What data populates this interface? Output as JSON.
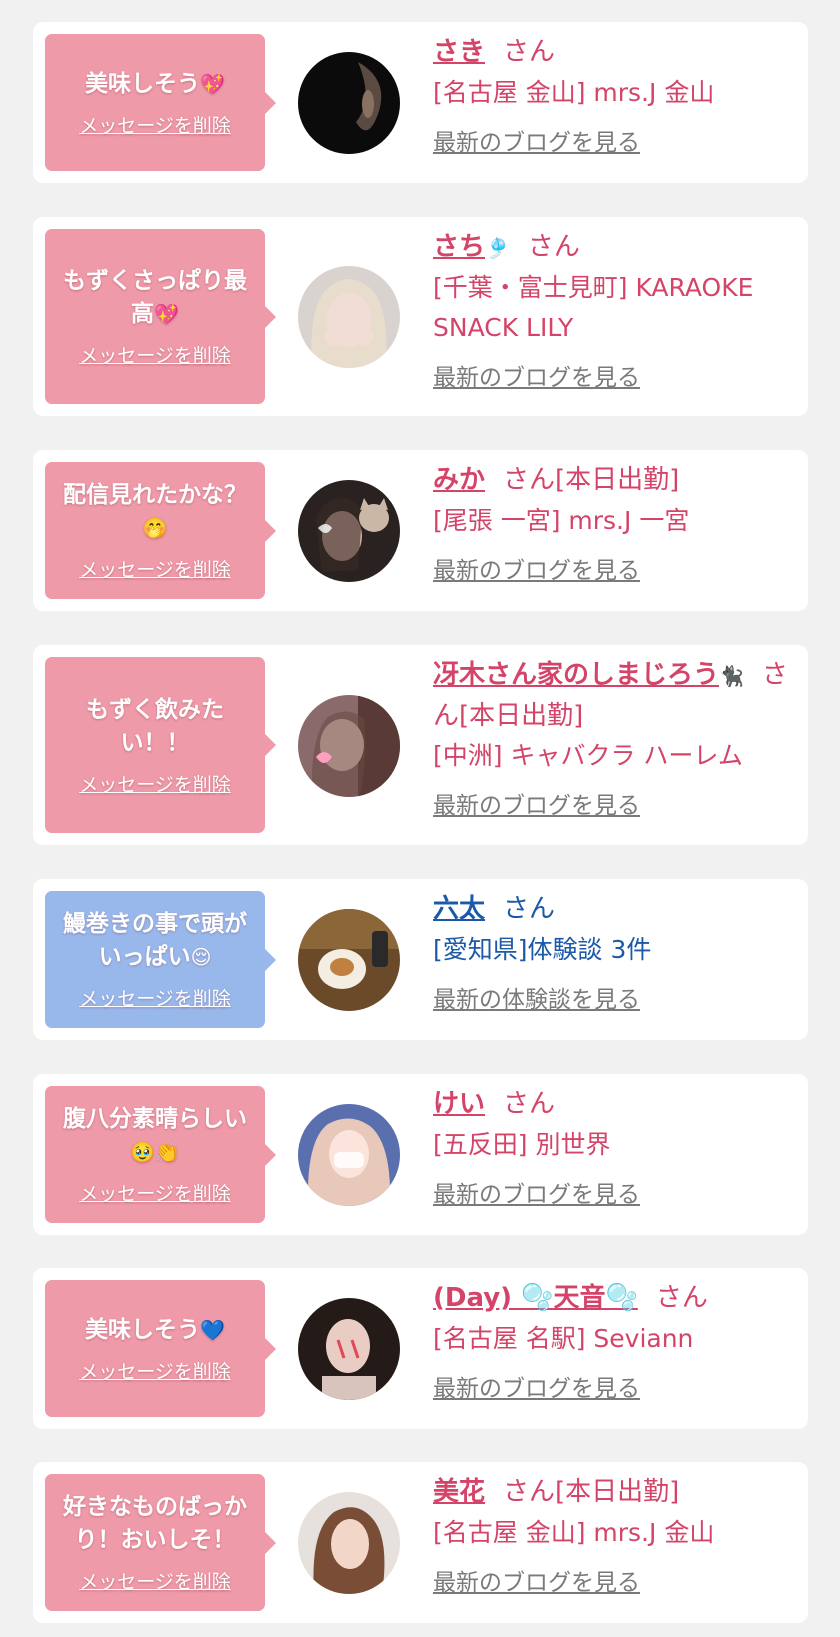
{
  "items": [
    {
      "bubble_text": "美味しそう",
      "bubble_emoji": "💖",
      "delete_label": "メッセージを削除",
      "name": "さき",
      "name_suffix": "",
      "honorific": "さん",
      "status": "",
      "shop": "[名古屋 金山] mrs.J 金山",
      "link_label": "最新のブログを見る"
    },
    {
      "bubble_text": "もずくさっぱり最高",
      "bubble_emoji": "💖",
      "delete_label": "メッセージを削除",
      "name": "さち",
      "name_suffix": "🎐",
      "honorific": "さん",
      "status": "",
      "shop": "[千葉・富士見町] KARAOKE SNACK LILY",
      "link_label": "最新のブログを見る"
    },
    {
      "bubble_text": "配信見れたかな？",
      "bubble_emoji": "🤭",
      "delete_label": "メッセージを削除",
      "name": "みか",
      "name_suffix": "",
      "honorific": "さん",
      "status": "[本日出勤]",
      "shop": "[尾張 一宮] mrs.J 一宮",
      "link_label": "最新のブログを見る"
    },
    {
      "bubble_text": "もずく飲みたい！！",
      "bubble_emoji": "",
      "delete_label": "メッセージを削除",
      "name": "冴木さん家のしまじろう",
      "name_suffix": "🐈‍⬛",
      "honorific": "さん",
      "status": "[本日出勤]",
      "shop": "[中洲] キャバクラ ハーレム",
      "link_label": "最新のブログを見る"
    },
    {
      "bubble_text": "鰻巻きの事で頭がいっぱい",
      "bubble_emoji": "😌",
      "delete_label": "メッセージを削除",
      "name": "六太",
      "name_suffix": "",
      "honorific": "さん",
      "status": "",
      "shop": "[愛知県]体験談 3件",
      "link_label": "最新の体験談を見る"
    },
    {
      "bubble_text": "腹八分素晴らしい",
      "bubble_emoji": "🥹👏",
      "delete_label": "メッセージを削除",
      "name": "けい",
      "name_suffix": "",
      "honorific": "さん",
      "status": "",
      "shop": "[五反田] 別世界",
      "link_label": "最新のブログを見る"
    },
    {
      "bubble_text": "美味しそう",
      "bubble_emoji": "💙",
      "delete_label": "メッセージを削除",
      "name": "(Day) 🫧天音🫧",
      "name_suffix": "",
      "honorific": "さん",
      "status": "",
      "shop": "[名古屋 名駅] Seviann",
      "link_label": "最新のブログを見る"
    },
    {
      "bubble_text": "好きなものばっかり！おいしそ！",
      "bubble_emoji": "",
      "delete_label": "メッセージを削除",
      "name": "美花",
      "name_suffix": "",
      "honorific": "さん",
      "status": "[本日出勤]",
      "shop": "[名古屋 金山] mrs.J 金山",
      "link_label": "最新のブログを見る"
    }
  ],
  "colors": {
    "page_bg": "#f1f1f1",
    "bubble_pink": "#ef9aa8",
    "bubble_blue": "#98b8ec",
    "name_pink": "#d44468",
    "name_blue": "#1c5aa8",
    "link_gray": "#7a7a7a"
  }
}
